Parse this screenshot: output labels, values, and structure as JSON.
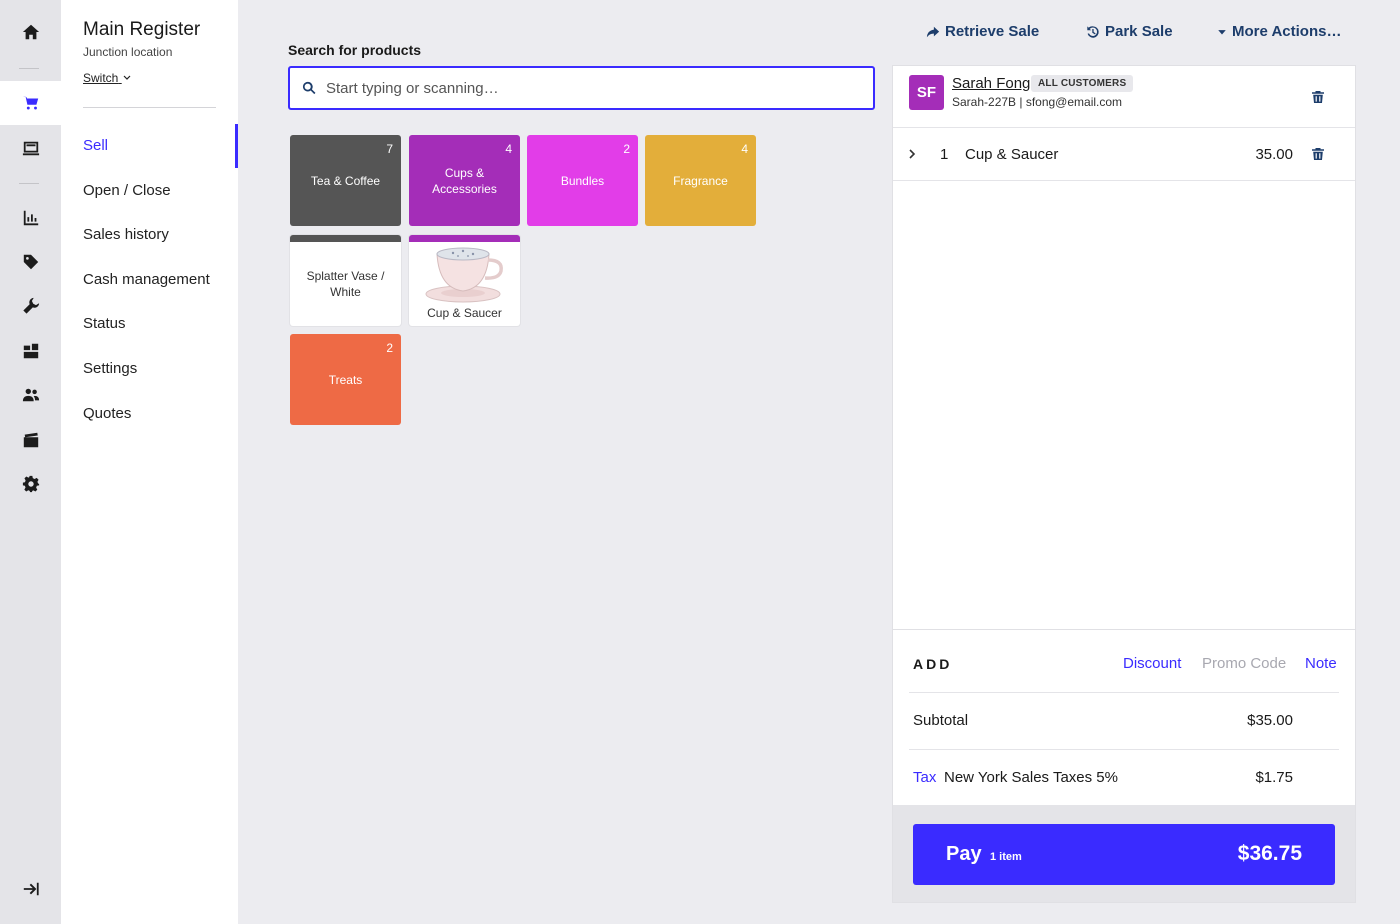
{
  "register": {
    "title": "Main Register",
    "location": "Junction location",
    "switch_label": "Switch"
  },
  "nav": {
    "items": [
      {
        "label": "Sell"
      },
      {
        "label": "Open / Close"
      },
      {
        "label": "Sales history"
      },
      {
        "label": "Cash management"
      },
      {
        "label": "Status"
      },
      {
        "label": "Settings"
      },
      {
        "label": "Quotes"
      }
    ]
  },
  "top_actions": {
    "retrieve": "Retrieve Sale",
    "park": "Park Sale",
    "more": "More Actions…"
  },
  "search": {
    "label": "Search for products",
    "placeholder": "Start typing or scanning…"
  },
  "tiles": [
    {
      "label": "Tea & Coffee",
      "count": "7",
      "color": "#555555"
    },
    {
      "label": "Cups & Accessories",
      "count": "4",
      "color": "#a42db8"
    },
    {
      "label": "Bundles",
      "count": "2",
      "color": "#e23de8"
    },
    {
      "label": "Fragrance",
      "count": "4",
      "color": "#e3ae3a"
    },
    {
      "label": "Splatter Vase / White",
      "color": "#555555"
    },
    {
      "label": "Cup & Saucer",
      "color": "#a42db8"
    },
    {
      "label": "Treats",
      "count": "2",
      "color": "#ee6a45"
    }
  ],
  "customer": {
    "initials": "SF",
    "name": "Sarah Fong",
    "group": "ALL CUSTOMERS",
    "meta": "Sarah-227B | sfong@email.com"
  },
  "line_items": [
    {
      "qty": "1",
      "name": "Cup & Saucer",
      "price": "35.00"
    }
  ],
  "add": {
    "label": "ADD",
    "discount": "Discount",
    "promo": "Promo Code",
    "note": "Note"
  },
  "totals": {
    "subtotal_label": "Subtotal",
    "subtotal": "$35.00",
    "tax_link": "Tax",
    "tax_label": "New York Sales Taxes 5%",
    "tax": "$1.75"
  },
  "pay": {
    "label": "Pay",
    "count": "1 item",
    "amount": "$36.75"
  },
  "colors": {
    "accent": "#3a2bff",
    "navy": "#1d3d6b",
    "avatar": "#a42db8"
  }
}
